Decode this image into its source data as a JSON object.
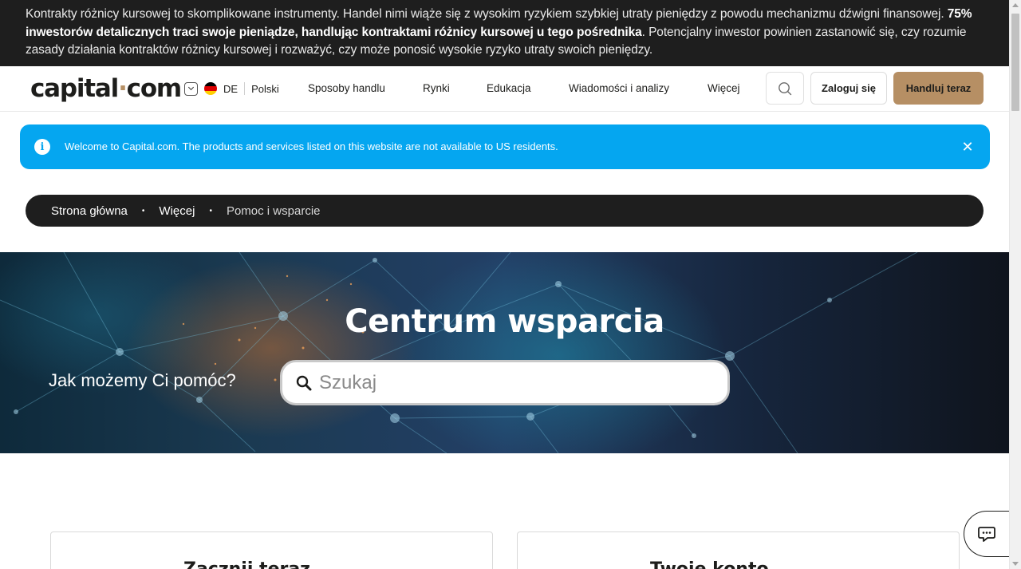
{
  "risk_warning": {
    "before": "Kontrakty różnicy kursowej to skomplikowane instrumenty. Handel nimi wiąże się z wysokim ryzykiem szybkiej utraty pieniędzy z powodu mechanizmu dźwigni finansowej. ",
    "bold": "75% inwestorów detalicznych traci swoje pieniądze, handlując kontraktami różnicy kursowej u tego pośrednika",
    "after": ". Potencjalny inwestor powinien zastanowić się, czy rozumie zasady działania kontraktów różnicy kursowej i rozważyć, czy może ponosić wysokie ryzyko utraty swoich pieniędzy."
  },
  "header": {
    "logo_left": "capital",
    "logo_dot": "·",
    "logo_right": "com",
    "region_code": "DE",
    "language": "Polski",
    "nav": [
      "Sposoby handlu",
      "Rynki",
      "Edukacja",
      "Wiadomości i analizy",
      "Więcej"
    ],
    "login_label": "Zaloguj się",
    "trade_label": "Handluj teraz",
    "brand_color": "#b68f64"
  },
  "notice": {
    "message": "Welcome to Capital.com. The products and services listed on this website are not available to US residents.",
    "close_symbol": "✕",
    "info_symbol": "i",
    "color": "#05a6f0"
  },
  "breadcrumb": {
    "items": [
      "Strona główna",
      "Więcej",
      "Pomoc i wsparcie"
    ],
    "separator": "•"
  },
  "hero": {
    "title": "Centrum wsparcia",
    "question": "Jak możemy Ci pomóc?",
    "search_placeholder": "Szukaj"
  },
  "cards": [
    {
      "title": "Zacznij teraz"
    },
    {
      "title": "Twoje konto"
    }
  ]
}
